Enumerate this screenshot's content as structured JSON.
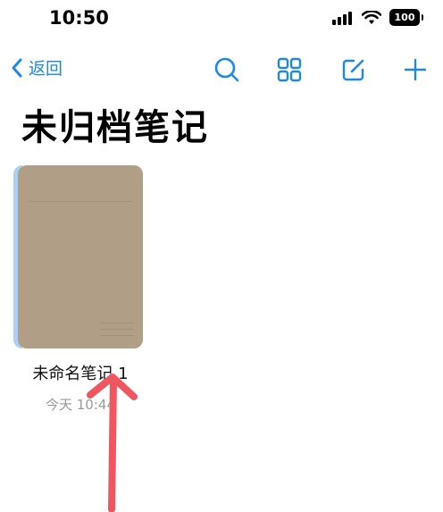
{
  "status_bar": {
    "time": "10:50",
    "battery": "100"
  },
  "nav": {
    "back_label": "返回"
  },
  "page": {
    "title": "未归档笔记"
  },
  "notes": [
    {
      "title": "未命名笔记 1",
      "date": "今天 10:44"
    }
  ],
  "colors": {
    "accent": "#1e88e5",
    "cover": "#b09f86",
    "spine": "#a9d1f5",
    "annotation_arrow": "#f0565f"
  }
}
